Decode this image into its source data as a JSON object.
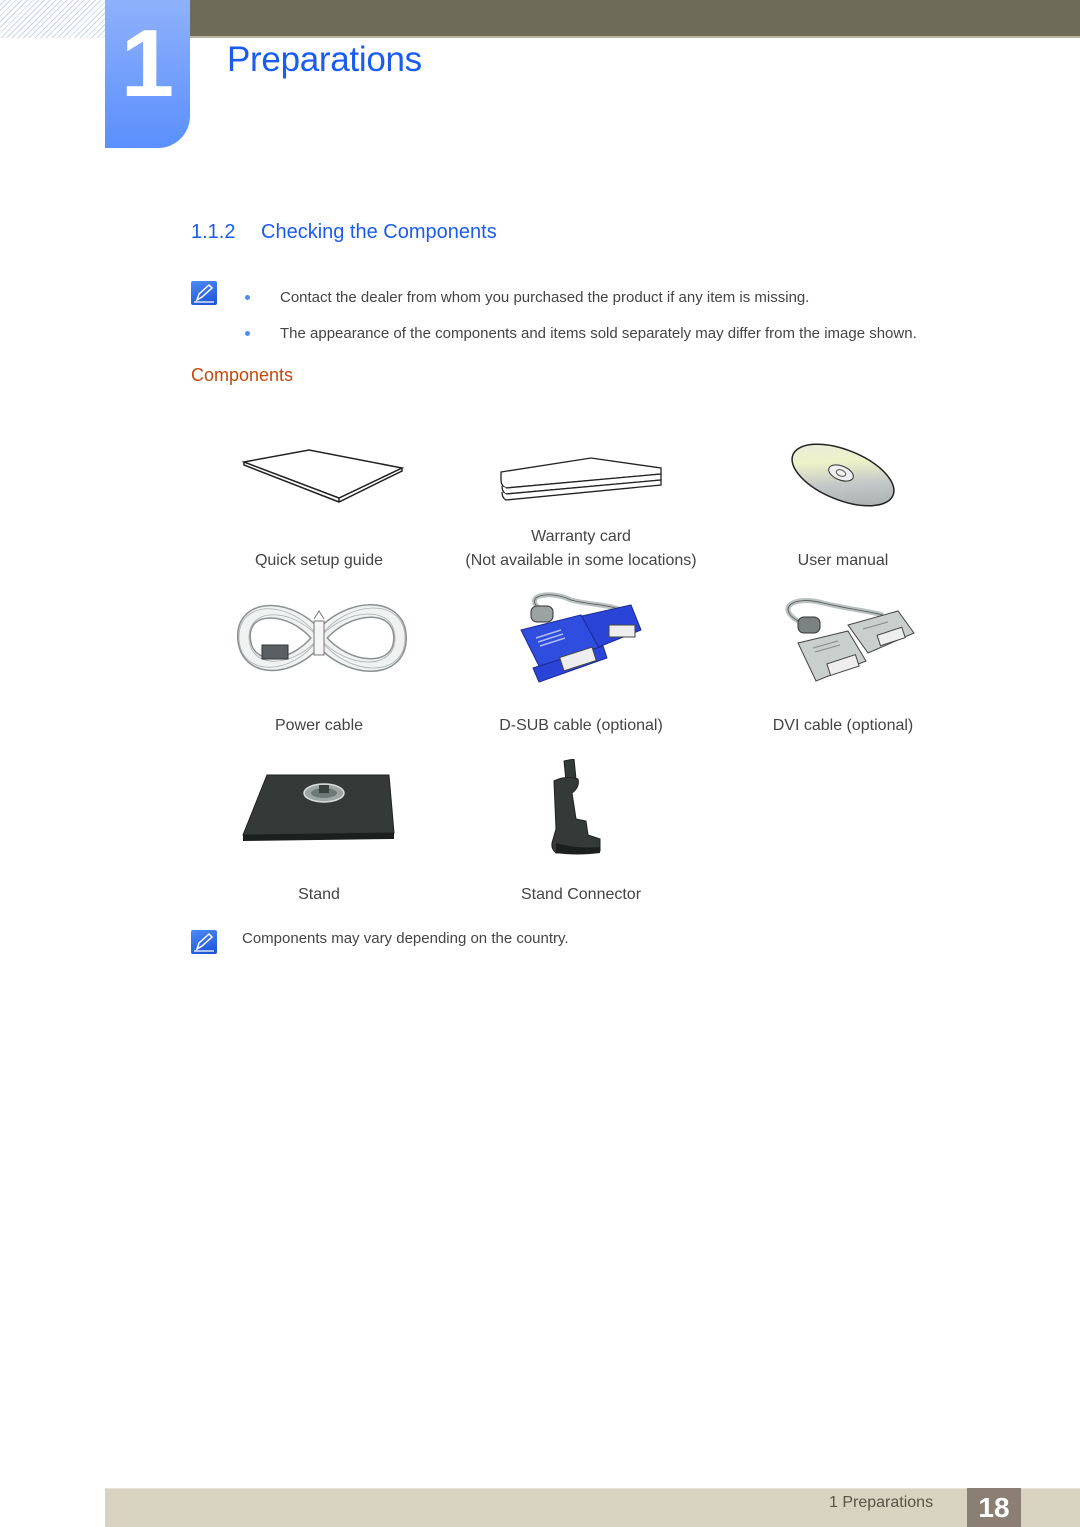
{
  "header": {
    "chapter_number": "1",
    "chapter_title": "Preparations"
  },
  "section": {
    "number": "1.1.2",
    "title": "Checking the Components",
    "notes": [
      "Contact the dealer from whom you purchased the product if any item is missing.",
      "The appearance of the components and items sold separately may differ from the image shown."
    ]
  },
  "components": {
    "heading": "Components",
    "items": [
      {
        "label": "Quick setup guide",
        "sublabel": "",
        "icon": "booklet-icon"
      },
      {
        "label": "Warranty card",
        "sublabel": "(Not available in some locations)",
        "icon": "card-icon"
      },
      {
        "label": "User manual",
        "sublabel": "",
        "icon": "cd-icon"
      },
      {
        "label": "Power cable",
        "sublabel": "",
        "icon": "power-cable-icon"
      },
      {
        "label": "D-SUB cable (optional)",
        "sublabel": "",
        "icon": "dsub-cable-icon"
      },
      {
        "label": "DVI cable (optional)",
        "sublabel": "",
        "icon": "dvi-cable-icon"
      },
      {
        "label": "Stand",
        "sublabel": "",
        "icon": "stand-icon"
      },
      {
        "label": "Stand Connector",
        "sublabel": "",
        "icon": "stand-connector-icon"
      }
    ],
    "footnote": "Components may vary depending on the country."
  },
  "footer": {
    "chapter_label": "1 Preparations",
    "page_number": "18"
  },
  "colors": {
    "accent_blue": "#1a5cf0",
    "subheading_orange": "#c2490c",
    "topbar": "#6d6c58",
    "footer_bar": "#d8d3c0",
    "page_badge": "#8b7f74"
  }
}
